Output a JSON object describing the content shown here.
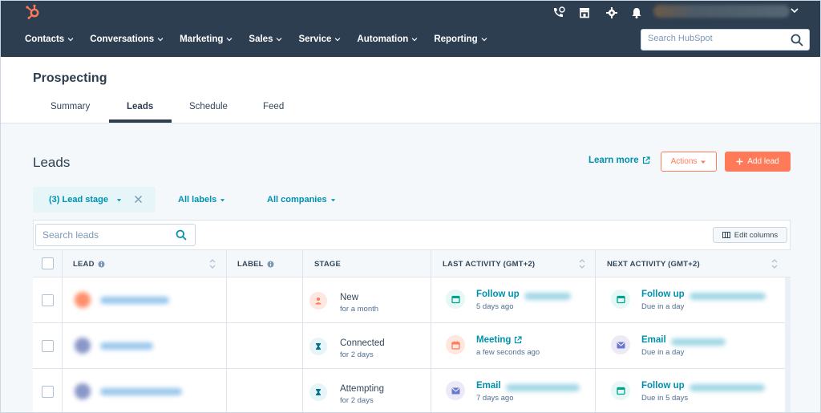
{
  "nav": {
    "items": [
      {
        "label": "Contacts"
      },
      {
        "label": "Conversations"
      },
      {
        "label": "Marketing"
      },
      {
        "label": "Sales"
      },
      {
        "label": "Service"
      },
      {
        "label": "Automation"
      },
      {
        "label": "Reporting"
      }
    ],
    "search_placeholder": "Search HubSpot",
    "utility_icons": [
      "phone-icon",
      "marketplace-icon",
      "settings-icon",
      "notifications-icon"
    ]
  },
  "page": {
    "title": "Prospecting",
    "tabs": [
      {
        "label": "Summary",
        "active": false
      },
      {
        "label": "Leads",
        "active": true
      },
      {
        "label": "Schedule",
        "active": false
      },
      {
        "label": "Feed",
        "active": false
      }
    ]
  },
  "leads": {
    "heading": "Leads",
    "learn_more": "Learn more",
    "actions_label": "Actions",
    "add_label": "Add lead",
    "filters": {
      "lead_stage": "(3) Lead stage",
      "all_labels": "All labels",
      "all_companies": "All companies"
    },
    "search_placeholder": "Search leads",
    "edit_columns": "Edit columns",
    "columns": {
      "lead": "LEAD",
      "label": "LABEL",
      "stage": "STAGE",
      "last_activity": "LAST ACTIVITY (GMT+2)",
      "next_activity": "NEXT ACTIVITY (GMT+2)"
    },
    "rows": [
      {
        "stage": "New",
        "stage_time": "for a month",
        "last_activity": "Follow up",
        "last_time": "5 days ago",
        "next_activity": "Follow up",
        "next_time": "Due in a day"
      },
      {
        "stage": "Connected",
        "stage_time": "for 2 days",
        "last_activity": "Meeting",
        "last_time": "a few seconds ago",
        "next_activity": "Email",
        "next_time": "Due in a day"
      },
      {
        "stage": "Attempting",
        "stage_time": "for 2 days",
        "last_activity": "Email",
        "last_time": "7 days ago",
        "next_activity": "Follow up",
        "next_time": "Due in 5 days"
      }
    ]
  },
  "colors": {
    "nav_bg": "#2d3e50",
    "accent_orange": "#ff7a59",
    "link_teal": "#0091ae"
  }
}
